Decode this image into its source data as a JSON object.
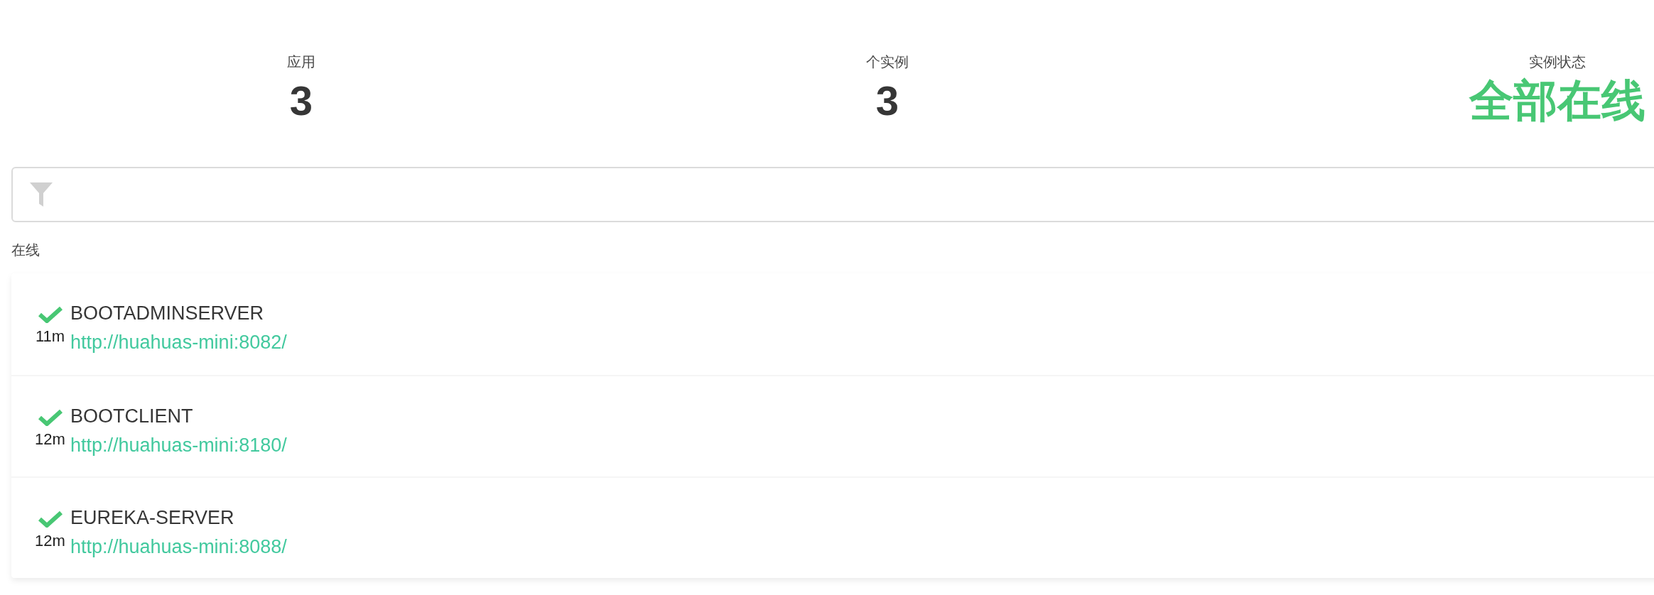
{
  "summary": [
    {
      "label": "应用",
      "value": "3",
      "kind": "count"
    },
    {
      "label": "个实例",
      "value": "3",
      "kind": "count"
    },
    {
      "label": "实例状态",
      "value": "全部在线",
      "kind": "status"
    }
  ],
  "filter": {
    "kind": "filter"
  },
  "groups": [
    {
      "title": "在线",
      "instances": [
        {
          "online": true,
          "name": "BOOTADMINSERVER",
          "uptime": "11m",
          "url": "http://huahuas-mini:8082/"
        },
        {
          "online": true,
          "name": "BOOTCLIENT",
          "uptime": "12m",
          "url": "http://huahuas-mini:8180/"
        },
        {
          "online": true,
          "name": "EUREKA-SERVER",
          "uptime": "12m",
          "url": "http://huahuas-mini:8088/"
        }
      ]
    }
  ]
}
